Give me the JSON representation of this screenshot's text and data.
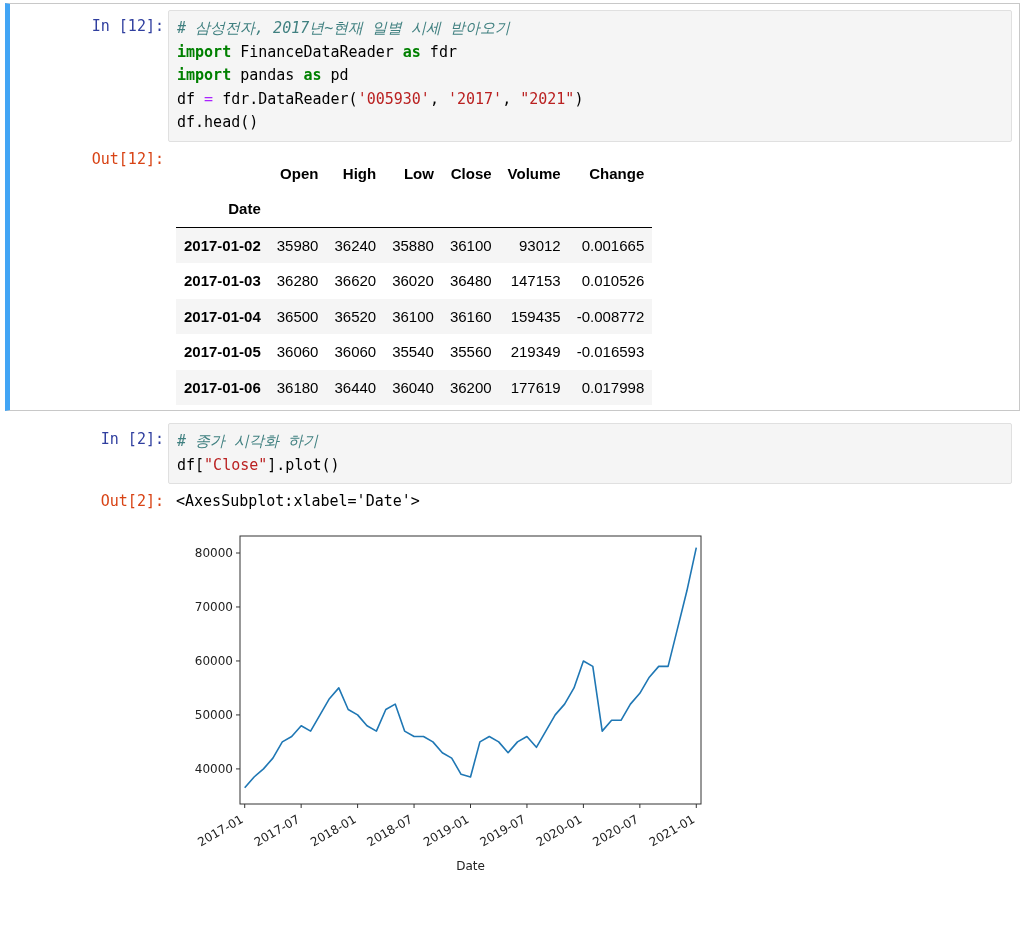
{
  "cells": [
    {
      "selected": true,
      "input_prompt": "In [12]:",
      "code_lines": [
        [
          {
            "kind": "comment",
            "text": "# 삼성전자, 2017년~현재 일별 시세 받아오기"
          }
        ],
        [
          {
            "kind": "keyword",
            "text": "import"
          },
          {
            "kind": "plain",
            "text": " FinanceDataReader "
          },
          {
            "kind": "keyword",
            "text": "as"
          },
          {
            "kind": "plain",
            "text": " fdr"
          }
        ],
        [
          {
            "kind": "keyword",
            "text": "import"
          },
          {
            "kind": "plain",
            "text": " pandas "
          },
          {
            "kind": "keyword",
            "text": "as"
          },
          {
            "kind": "plain",
            "text": " pd"
          }
        ],
        [
          {
            "kind": "plain",
            "text": "df "
          },
          {
            "kind": "operator",
            "text": "="
          },
          {
            "kind": "plain",
            "text": " fdr.DataReader("
          },
          {
            "kind": "string",
            "text": "'005930'"
          },
          {
            "kind": "plain",
            "text": ", "
          },
          {
            "kind": "string",
            "text": "'2017'"
          },
          {
            "kind": "plain",
            "text": ", "
          },
          {
            "kind": "string",
            "text": "\"2021\""
          },
          {
            "kind": "plain",
            "text": ")"
          }
        ],
        [
          {
            "kind": "plain",
            "text": "df.head()"
          }
        ]
      ],
      "output_prompt": "Out[12]:",
      "output": {
        "kind": "table",
        "columns": [
          "Open",
          "High",
          "Low",
          "Close",
          "Volume",
          "Change"
        ],
        "index_name": "Date",
        "rows": [
          {
            "index": "2017-01-02",
            "values": [
              "35980",
              "36240",
              "35880",
              "36100",
              "93012",
              "0.001665"
            ]
          },
          {
            "index": "2017-01-03",
            "values": [
              "36280",
              "36620",
              "36020",
              "36480",
              "147153",
              "0.010526"
            ]
          },
          {
            "index": "2017-01-04",
            "values": [
              "36500",
              "36520",
              "36100",
              "36160",
              "159435",
              "-0.008772"
            ]
          },
          {
            "index": "2017-01-05",
            "values": [
              "36060",
              "36060",
              "35540",
              "35560",
              "219349",
              "-0.016593"
            ]
          },
          {
            "index": "2017-01-06",
            "values": [
              "36180",
              "36440",
              "36040",
              "36200",
              "177619",
              "0.017998"
            ]
          }
        ]
      }
    },
    {
      "selected": false,
      "input_prompt": "In [2]:",
      "code_lines": [
        [
          {
            "kind": "comment",
            "text": "# 종가 시각화 하기"
          }
        ],
        [
          {
            "kind": "plain",
            "text": "df["
          },
          {
            "kind": "string",
            "text": "\"Close\""
          },
          {
            "kind": "plain",
            "text": "].plot()"
          }
        ]
      ],
      "output_prompt": "Out[2]:",
      "output": {
        "kind": "plot",
        "text": "<AxesSubplot:xlabel='Date'>",
        "chart_data": {
          "type": "line",
          "xlabel": "Date",
          "categories": [
            "2017-01",
            null,
            null,
            null,
            null,
            null,
            "2017-07",
            null,
            null,
            null,
            null,
            null,
            "2018-01",
            null,
            null,
            null,
            null,
            null,
            "2018-07",
            null,
            null,
            null,
            null,
            null,
            "2019-01",
            null,
            null,
            null,
            null,
            null,
            "2019-07",
            null,
            null,
            null,
            null,
            null,
            "2020-01",
            null,
            null,
            null,
            null,
            null,
            "2020-07",
            null,
            null,
            null,
            null,
            null,
            "2021-01"
          ],
          "series": [
            {
              "color": "#1f77b4",
              "values": [
                36500,
                38500,
                40000,
                42000,
                45000,
                46000,
                48000,
                47000,
                50000,
                53000,
                55000,
                51000,
                50000,
                48000,
                47000,
                51000,
                52000,
                47000,
                46000,
                46000,
                45000,
                43000,
                42000,
                39000,
                38500,
                45000,
                46000,
                45000,
                43000,
                45000,
                46000,
                44000,
                47000,
                50000,
                52000,
                55000,
                60000,
                59000,
                47000,
                49000,
                49000,
                52000,
                54000,
                57000,
                59000,
                59000,
                66000,
                73000,
                81000
              ]
            }
          ],
          "ylim": [
            33500,
            83150
          ],
          "yticks": [
            40000,
            50000,
            60000,
            70000,
            80000
          ]
        }
      }
    }
  ]
}
